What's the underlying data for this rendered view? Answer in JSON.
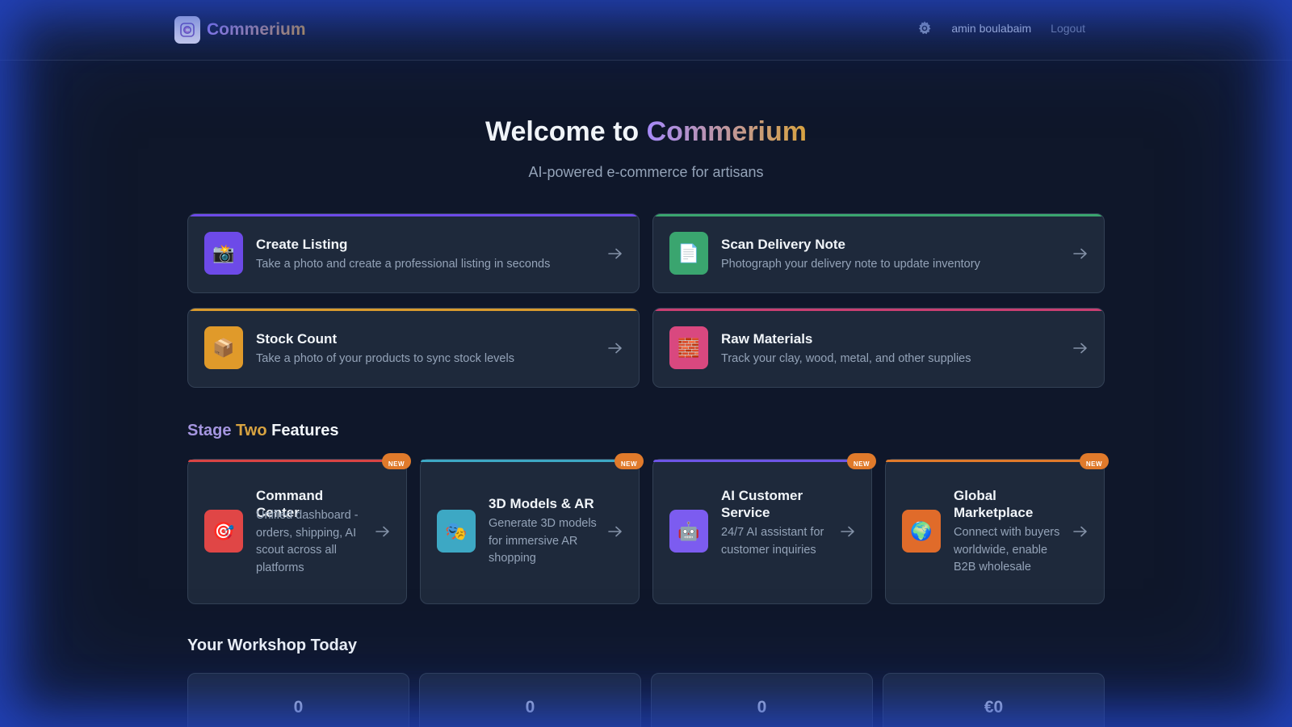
{
  "header": {
    "brand": "Commerium",
    "user_name": "amin boulabaim",
    "logout_label": "Logout",
    "settings_icon": "gear-icon"
  },
  "hero": {
    "title_prefix": "Welcome to ",
    "title_brand": "Commerium",
    "subtitle": "AI-powered e-commerce for artisans"
  },
  "actions": [
    {
      "title": "Create Listing",
      "desc": "Take a photo and create a professional listing in seconds",
      "icon": "camera-flash-icon",
      "glyph": "📸",
      "color": "#6d4ae8",
      "bar": "#6d4ae8"
    },
    {
      "title": "Scan Delivery Note",
      "desc": "Photograph your delivery note to update inventory",
      "icon": "document-icon",
      "glyph": "📄",
      "color": "#3aa56f",
      "bar": "#3aa56f"
    },
    {
      "title": "Stock Count",
      "desc": "Take a photo of your products to sync stock levels",
      "icon": "package-icon",
      "glyph": "📦",
      "color": "#e09a2a",
      "bar": "#d89a2e"
    },
    {
      "title": "Raw Materials",
      "desc": "Track your clay, wood, metal, and other supplies",
      "icon": "bricks-icon",
      "glyph": "🧱",
      "color": "#d9487f",
      "bar": "#c93f72"
    }
  ],
  "stage_two": {
    "heading_part1": "Stage",
    "heading_part2": "Two",
    "heading_part3": "Features",
    "badge": "NEW",
    "features": [
      {
        "title": "Command Center",
        "desc": "Unified dashboard - orders, shipping, AI scout across all platforms",
        "icon": "target-icon",
        "glyph": "🎯",
        "color": "#e04646",
        "bar": "#d94444"
      },
      {
        "title": "3D Models & AR",
        "desc": "Generate 3D models for immersive AR shopping",
        "icon": "ar-mask-icon",
        "glyph": "🎭",
        "color": "#3da8c4",
        "bar": "#3da8c4"
      },
      {
        "title": "AI Customer Service",
        "desc": "24/7 AI assistant for customer inquiries",
        "icon": "robot-icon",
        "glyph": "🤖",
        "color": "#7c5cf0",
        "bar": "#6d55e6"
      },
      {
        "title": "Global Marketplace",
        "desc": "Connect with buyers worldwide, enable B2B wholesale",
        "icon": "globe-icon",
        "glyph": "🌍",
        "color": "#e06b2a",
        "bar": "#e07a2b"
      }
    ]
  },
  "workshop": {
    "heading": "Your Workshop Today",
    "stats": [
      "0",
      "0",
      "0",
      "€0"
    ]
  }
}
